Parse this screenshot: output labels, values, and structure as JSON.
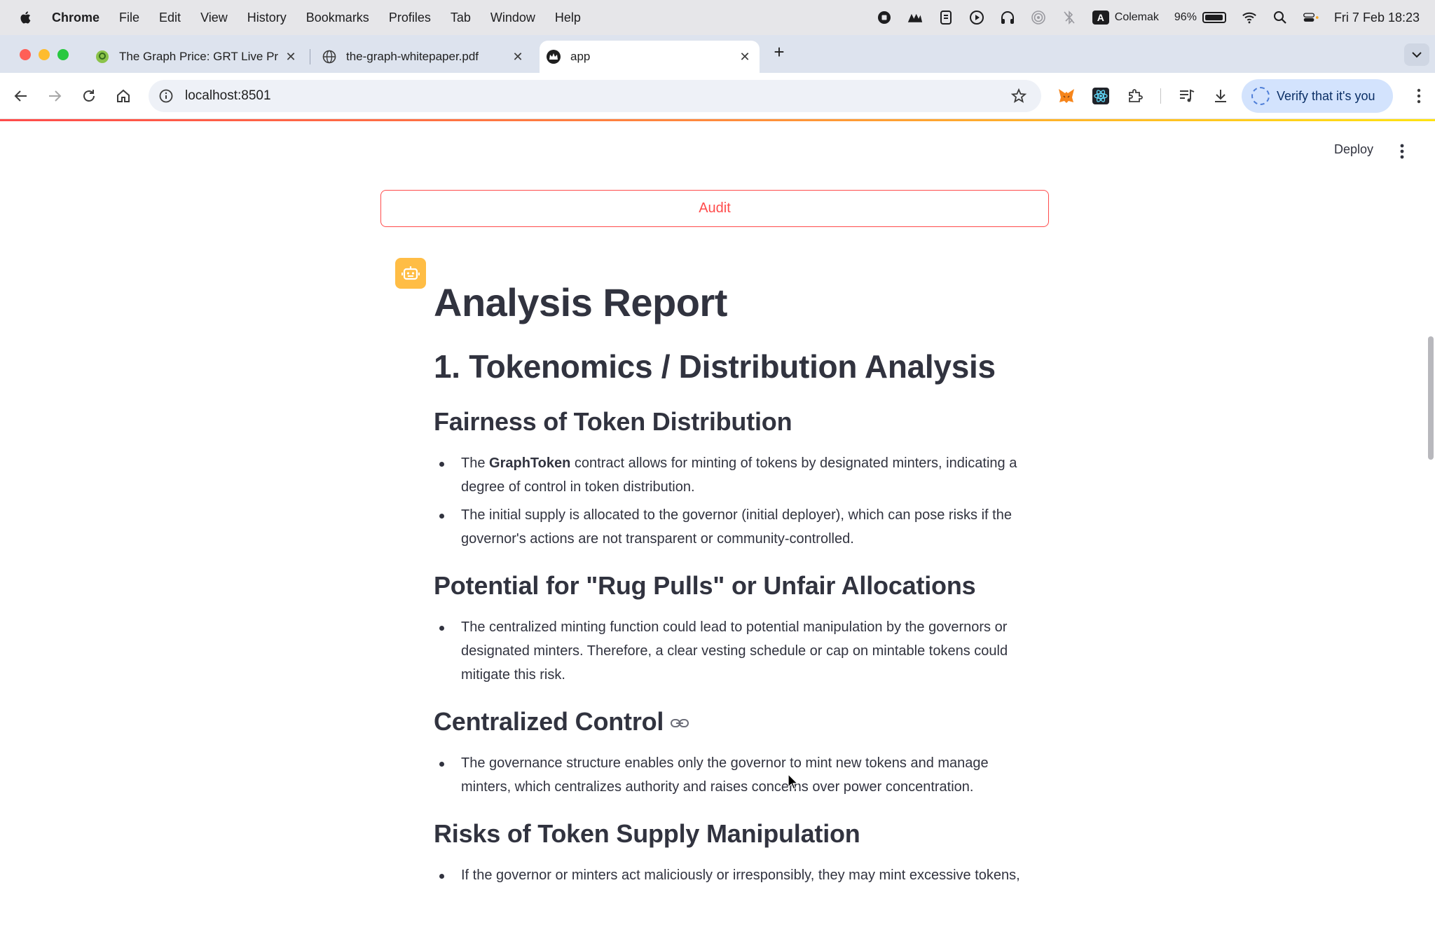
{
  "menubar": {
    "app_name": "Chrome",
    "items": [
      "File",
      "Edit",
      "View",
      "History",
      "Bookmarks",
      "Profiles",
      "Tab",
      "Window",
      "Help"
    ],
    "input_source": "Colemak",
    "input_badge": "A",
    "battery": "96%",
    "battery_level": 0.96,
    "datetime": "Fri 7 Feb  18:23"
  },
  "tabs": [
    {
      "title": "The Graph Price: GRT Live Pri",
      "favicon": "graph-favicon",
      "active": false
    },
    {
      "title": "the-graph-whitepaper.pdf",
      "favicon": "globe-icon",
      "active": false
    },
    {
      "title": "app",
      "favicon": "streamlit-crown-icon",
      "active": true
    }
  ],
  "toolbar": {
    "url": "localhost:8501",
    "verify_label": "Verify that it's you"
  },
  "streamlit": {
    "deploy_label": "Deploy",
    "audit_label": "Audit"
  },
  "report": {
    "title": "Analysis Report",
    "section_title": "1. Tokenomics / Distribution Analysis",
    "subsections": [
      {
        "heading": "Fairness of Token Distribution",
        "bullets": [
          {
            "pre": "The ",
            "bold": "GraphToken",
            "post": " contract allows for minting of tokens by designated minters, indicating a degree of control in token distribution."
          },
          {
            "pre": "",
            "bold": "",
            "post": "The initial supply is allocated to the governor (initial deployer), which can pose risks if the governor's actions are not transparent or community-controlled."
          }
        ]
      },
      {
        "heading": "Potential for \"Rug Pulls\" or Unfair Allocations",
        "bullets": [
          {
            "pre": "",
            "bold": "",
            "post": "The centralized minting function could lead to potential manipulation by the governors or designated minters. Therefore, a clear vesting schedule or cap on mintable tokens could mitigate this risk."
          }
        ]
      },
      {
        "heading": "Centralized Control",
        "bullets": [
          {
            "pre": "",
            "bold": "",
            "post": "The governance structure enables only the governor to mint new tokens and manage minters, which centralizes authority and raises concerns over power concentration."
          }
        ]
      },
      {
        "heading": "Risks of Token Supply Manipulation",
        "bullets": [
          {
            "pre": "",
            "bold": "",
            "post": "If the governor or minters act maliciously or irresponsibly, they may mint excessive tokens,"
          }
        ]
      }
    ]
  },
  "colors": {
    "accent": "#ff4b4b",
    "avatar": "#ffbd45",
    "text": "#31333f",
    "tabstrip": "#dde3ee"
  }
}
